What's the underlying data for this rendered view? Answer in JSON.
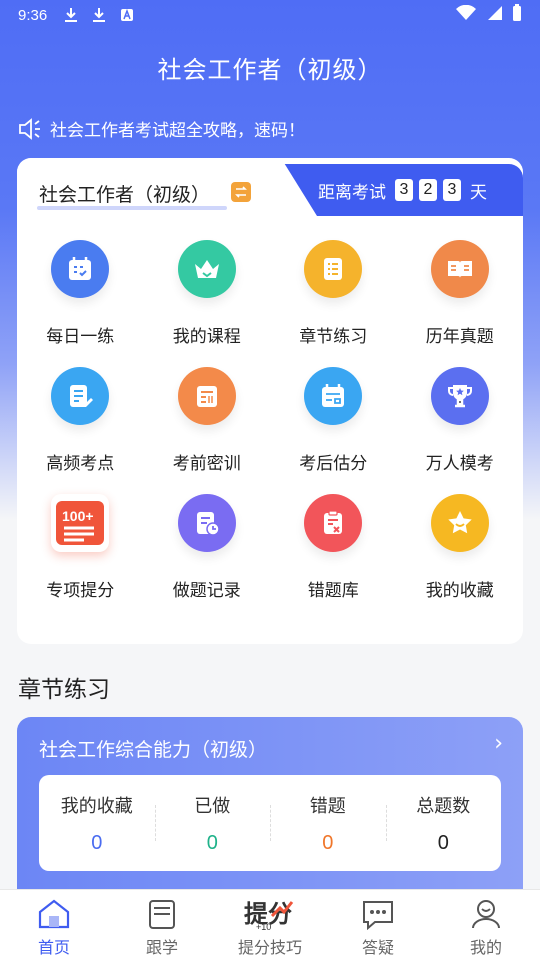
{
  "status_bar": {
    "time": "9:36"
  },
  "header": {
    "title": "社会工作者（初级）",
    "notice": "社会工作者考试超全攻略，速码！"
  },
  "exam_card": {
    "exam_name": "社会工作者（初级）",
    "countdown_label": "距离考试",
    "countdown_digits": [
      "3",
      "2",
      "3"
    ],
    "countdown_unit": "天",
    "items": [
      {
        "label": "每日一练",
        "icon": "calendar-check-icon",
        "color": "#4a7cf0"
      },
      {
        "label": "我的课程",
        "icon": "crown-icon",
        "color": "#34c9a2"
      },
      {
        "label": "章节练习",
        "icon": "list-doc-icon",
        "color": "#f5b32c"
      },
      {
        "label": "历年真题",
        "icon": "open-book-icon",
        "color": "#f0894a"
      },
      {
        "label": "高频考点",
        "icon": "edit-doc-icon",
        "color": "#3aa6f2"
      },
      {
        "label": "考前密训",
        "icon": "training-doc-icon",
        "color": "#f38a4a"
      },
      {
        "label": "考后估分",
        "icon": "score-calendar-icon",
        "color": "#3aa6f2"
      },
      {
        "label": "万人模考",
        "icon": "trophy-icon",
        "color": "#5b6ff0"
      },
      {
        "label": "专项提分",
        "icon": "score-100-icon",
        "color": "#f0553a"
      },
      {
        "label": "做题记录",
        "icon": "record-clock-icon",
        "color": "#7a6cf2"
      },
      {
        "label": "错题库",
        "icon": "wrong-clipboard-icon",
        "color": "#f2555a"
      },
      {
        "label": "我的收藏",
        "icon": "star-icon",
        "color": "#f6b822"
      }
    ]
  },
  "chapter": {
    "section_title": "章节练习",
    "card_title": "社会工作综合能力（初级）",
    "arrow": "›",
    "stats": [
      {
        "label": "我的收藏",
        "value": "0",
        "color": "#4a6cf0"
      },
      {
        "label": "已做",
        "value": "0",
        "color": "#1fb28a"
      },
      {
        "label": "错题",
        "value": "0",
        "color": "#f0762a"
      },
      {
        "label": "总题数",
        "value": "0",
        "color": "#222222"
      }
    ]
  },
  "tabbar": {
    "tabs": [
      {
        "label": "首页",
        "icon": "home-icon",
        "active": true
      },
      {
        "label": "跟学",
        "icon": "book-icon",
        "active": false
      },
      {
        "label": "提分技巧",
        "icon": "score-tips-icon",
        "active": false
      },
      {
        "label": "答疑",
        "icon": "chat-icon",
        "active": false
      },
      {
        "label": "我的",
        "icon": "profile-icon",
        "active": false
      }
    ]
  }
}
